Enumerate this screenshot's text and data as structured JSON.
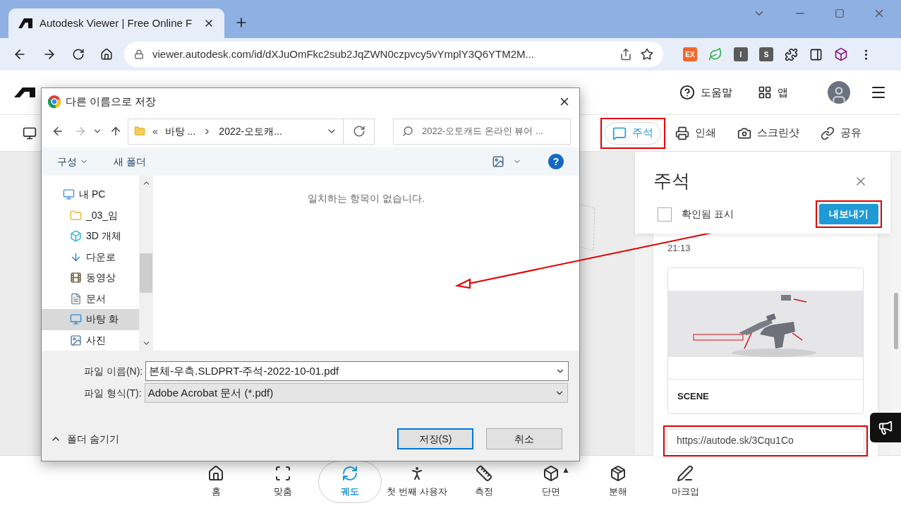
{
  "browser": {
    "tab_title": "Autodesk Viewer | Free Online F",
    "address": "viewer.autodesk.com/id/dXJuOmFkc2sub2JqZWN0czpvcy5vYmplY3Q6YTM2M...",
    "extensions": [
      {
        "label": "EX",
        "color": "#f0682a"
      },
      {
        "label": "I",
        "color": "#5a5a5a"
      },
      {
        "label": "S",
        "color": "#5a5a5a"
      }
    ]
  },
  "header": {
    "help": "도움말",
    "apps": "앱"
  },
  "toolbar": [
    {
      "label": "주석",
      "selected": true
    },
    {
      "label": "인쇄",
      "selected": false
    },
    {
      "label": "스크린샷",
      "selected": false
    },
    {
      "label": "공유",
      "selected": false
    }
  ],
  "panel": {
    "title": "주석",
    "checkbox": {
      "label": "확인됨 표시",
      "checked": false
    },
    "export": "내보내기",
    "time": "21:13",
    "scene": "SCENE",
    "link": "https://autode.sk/3Cqu1Co"
  },
  "bottom_toolbar": [
    {
      "label": "홈",
      "selected": false
    },
    {
      "label": "맞춤",
      "selected": false
    },
    {
      "label": "궤도",
      "selected": true
    },
    {
      "label": "첫 번째 사용자",
      "selected": false
    },
    {
      "label": "측정",
      "selected": false
    },
    {
      "label": "단면",
      "selected": false,
      "menu_glyph": "▲"
    },
    {
      "label": "분해",
      "selected": false
    },
    {
      "label": "마크업",
      "selected": false
    }
  ],
  "dialog": {
    "title": "다른 이름으로 저장",
    "path_prefix": "«",
    "path": [
      "바탕 ...",
      "2022-오토캐..."
    ],
    "search_placeholder": "2022-오토캐드 온라인 뷰어 ...",
    "organize": "구성",
    "new_folder": "새 폴더",
    "help": "?",
    "nav": [
      {
        "label": "내 PC",
        "selected": false
      },
      {
        "label": "_03_임",
        "selected": false
      },
      {
        "label": "3D 개체",
        "selected": false
      },
      {
        "label": "다운로",
        "selected": false
      },
      {
        "label": "동영상",
        "selected": false
      },
      {
        "label": "문서",
        "selected": false
      },
      {
        "label": "바탕 화",
        "selected": true
      },
      {
        "label": "사진",
        "selected": false
      }
    ],
    "empty_message": "일치하는 항목이 없습니다.",
    "file_name": {
      "label": "파일 이름(N):",
      "value": "본체-우측.SLDPRT-주석-2022-10-01.pdf"
    },
    "file_type": {
      "label": "파일 형식(T):",
      "value": "Adobe Acrobat 문서 (*.pdf)"
    },
    "hide_folders": "폴더 숨기기",
    "buttons": [
      {
        "label": "저장(S)",
        "kind": "primary"
      },
      {
        "label": "취소",
        "kind": "secondary"
      }
    ]
  }
}
